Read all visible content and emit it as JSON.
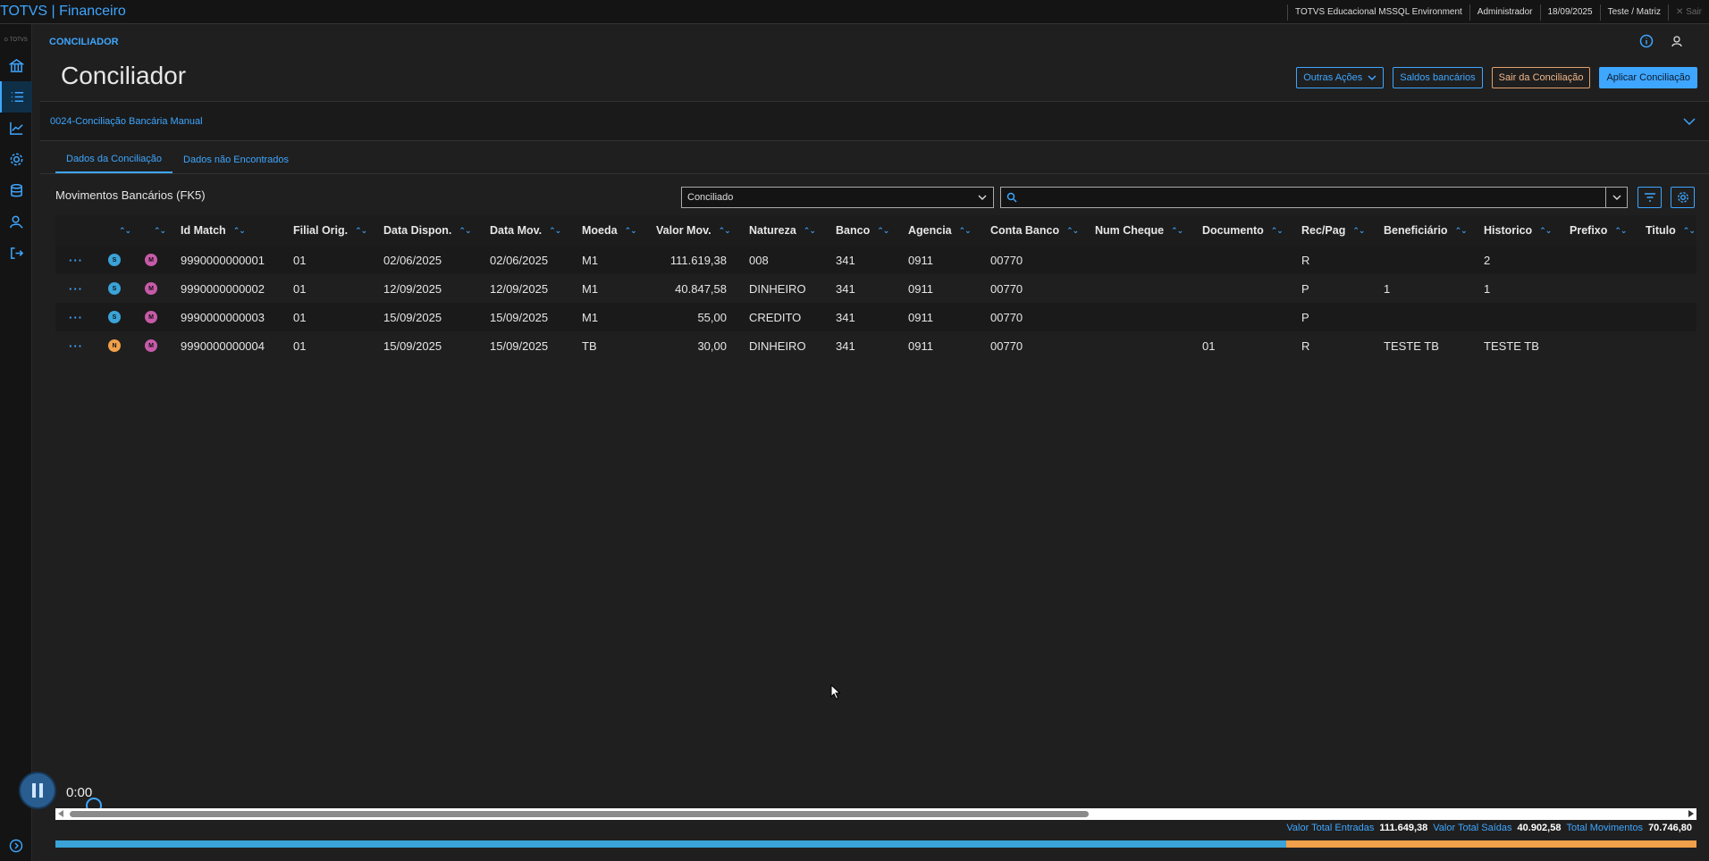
{
  "topbar": {
    "app_title": "TOTVS | Financeiro",
    "environment": "TOTVS Educacional MSSQL Environment",
    "user": "Administrador",
    "date": "18/09/2025",
    "branch": "Teste / Matriz",
    "exit_label": "Sair"
  },
  "sidebar": {
    "logo": "TOTVS"
  },
  "header": {
    "breadcrumb": "CONCILIADOR",
    "title": "Conciliador",
    "buttons": {
      "other_actions": "Outras Ações",
      "bank_balances": "Saldos bancários",
      "exit_reconciliation": "Sair da Conciliação",
      "apply_reconciliation": "Aplicar Conciliação"
    }
  },
  "collapse": {
    "label": "0024-Conciliação Bancária Manual"
  },
  "tabs": [
    {
      "label": "Dados da Conciliação"
    },
    {
      "label": "Dados não Encontrados"
    }
  ],
  "grid": {
    "title": "Movimentos Bancários (FK5)",
    "filter_value": "Conciliado",
    "search_placeholder": "",
    "columns": [
      "Id Match",
      "Filial Orig.",
      "Data Dispon.",
      "Data Mov.",
      "Moeda",
      "Valor Mov.",
      "Natureza",
      "Banco",
      "Agencia",
      "Conta Banco",
      "Num Cheque",
      "Documento",
      "Rec/Pag",
      "Beneficiário",
      "Historico",
      "Prefixo",
      "Titulo"
    ],
    "rows": [
      {
        "status": "S",
        "type": "M",
        "cells": [
          "9990000000001",
          "01",
          "02/06/2025",
          "02/06/2025",
          "M1",
          "111.619,38",
          "008",
          "341",
          "0911",
          "00770",
          "",
          "",
          "R",
          "",
          "2",
          "",
          ""
        ]
      },
      {
        "status": "S",
        "type": "M",
        "cells": [
          "9990000000002",
          "01",
          "12/09/2025",
          "12/09/2025",
          "M1",
          "40.847,58",
          "DINHEIRO",
          "341",
          "0911",
          "00770",
          "",
          "",
          "P",
          "1",
          "1",
          "",
          ""
        ]
      },
      {
        "status": "S",
        "type": "M",
        "cells": [
          "9990000000003",
          "01",
          "15/09/2025",
          "15/09/2025",
          "M1",
          "55,00",
          "CREDITO",
          "341",
          "0911",
          "00770",
          "",
          "",
          "P",
          "",
          "",
          "",
          ""
        ]
      },
      {
        "status": "N",
        "type": "M",
        "cells": [
          "9990000000004",
          "01",
          "15/09/2025",
          "15/09/2025",
          "TB",
          "30,00",
          "DINHEIRO",
          "341",
          "0911",
          "00770",
          "",
          "01",
          "R",
          "TESTE TB",
          "TESTE TB",
          "",
          ""
        ]
      }
    ]
  },
  "media": {
    "time": "0:00"
  },
  "totals": {
    "entradas_label": "Valor Total Entradas",
    "entradas_value": "111.649,38",
    "saidas_label": "Valor Total Saídas",
    "saidas_value": "40.902,58",
    "movimentos_label": "Total Movimentos",
    "movimentos_value": "70.746,80",
    "entradas_share": 0.75
  },
  "colors": {
    "accent": "#3ea6ff",
    "warn": "#f0a04a",
    "status_s": "#3aa3d8",
    "status_m": "#c75aa8"
  }
}
